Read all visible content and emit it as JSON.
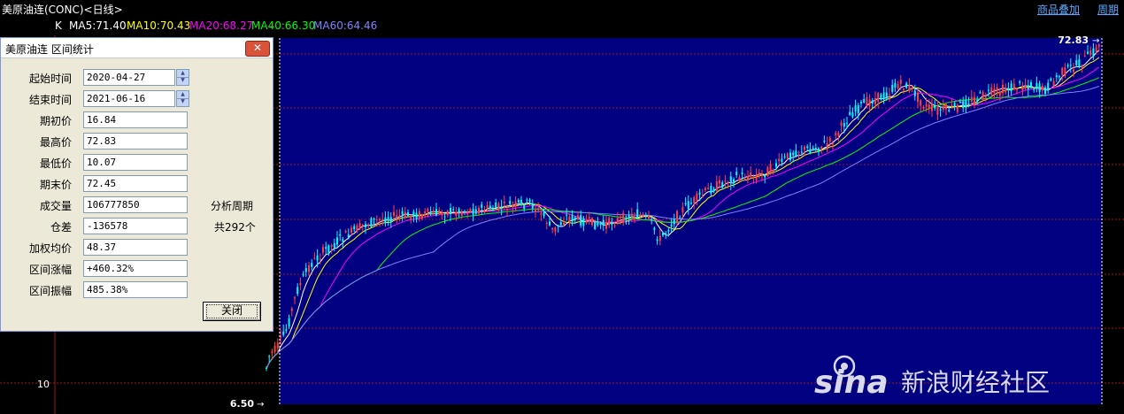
{
  "header": {
    "title": "美原油连(CONC)<日线>",
    "links": [
      "商品叠加",
      "周期"
    ]
  },
  "ma_legend": {
    "k_label": "K",
    "items": [
      {
        "text": "MA5:71.40",
        "color": "#ffffff"
      },
      {
        "text": "MA10:70.43",
        "color": "#ffff00"
      },
      {
        "text": "MA20:68.27",
        "color": "#ff00ff"
      },
      {
        "text": "MA40:66.30",
        "color": "#00ff00"
      },
      {
        "text": "MA60:64.46",
        "color": "#8080ff"
      }
    ]
  },
  "dialog": {
    "title": "美原油连 区间统计",
    "close_icon": "close-x-icon",
    "fields": [
      {
        "label": "起始时间",
        "value": "2020-04-27"
      },
      {
        "label": "结束时间",
        "value": "2021-06-16"
      },
      {
        "label": "期初价",
        "value": "16.84"
      },
      {
        "label": "最高价",
        "value": "72.83"
      },
      {
        "label": "最低价",
        "value": "10.07"
      },
      {
        "label": "期末价",
        "value": "72.45"
      },
      {
        "label": "成交量",
        "value": "106777850"
      },
      {
        "label": "仓差",
        "value": "-136578"
      },
      {
        "label": "加权均价",
        "value": "48.37"
      },
      {
        "label": "区间涨幅",
        "value": "+460.32%"
      },
      {
        "label": "区间振幅",
        "value": "485.38%"
      }
    ],
    "side_label_1": "分析周期",
    "side_label_2": "共292个",
    "close_button": "关闭"
  },
  "axis": {
    "high_marker": "72.83",
    "low_marker": "6.50",
    "y_tick": "10"
  },
  "watermark": {
    "logo": "sina",
    "text": "新浪财经社区"
  },
  "colors": {
    "panel_bg": "#000080",
    "bull": "#ff4040",
    "bear": "#00ffff",
    "grid": "#a01818"
  }
}
